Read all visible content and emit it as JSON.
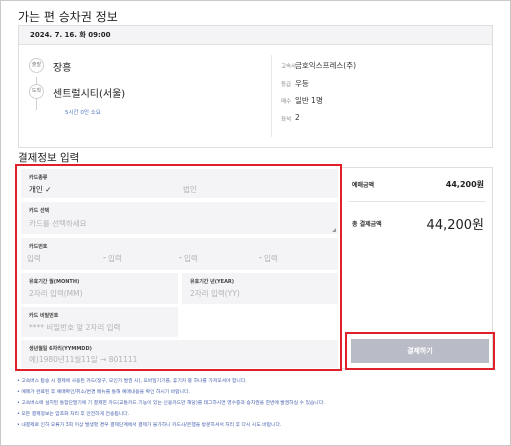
{
  "page": {
    "section_ticket_title": "가는 편 승차권 정보",
    "section_payment_title": "결제정보 입력"
  },
  "ticket": {
    "datetime": "2024. 7. 16. 화 09:00",
    "departure_badge": "출발",
    "arrival_badge": "도착",
    "departure": "장흥",
    "arrival": "센트럴시티(서울)",
    "duration": "5시간 0인 소요",
    "info": [
      {
        "label": "고속사",
        "value": "금호익스프레스(주)"
      },
      {
        "label": "등급",
        "value": "우등"
      },
      {
        "label": "매수",
        "value": "일반 1명"
      },
      {
        "label": "좌석",
        "value": "2"
      }
    ]
  },
  "form": {
    "card_type": {
      "label": "카드종류",
      "selected": "개인 ✓",
      "other": "법인"
    },
    "card_select": {
      "label": "카드 선택",
      "placeholder": "카드를 선택하세요"
    },
    "card_number": {
      "label": "카드번호",
      "placeholders": [
        "입력",
        "입력",
        "입력",
        "입력"
      ],
      "separator": "-"
    },
    "expiry_month": {
      "label": "유효기간 월(MONTH)",
      "placeholder": "2자리 입력(MM)"
    },
    "expiry_year": {
      "label": "유효기간 년(YEAR)",
      "placeholder": "2자리 입력(YY)"
    },
    "card_password": {
      "label": "카드 비밀번호",
      "placeholder": "**** 비밀번호 앞 2자리 입력"
    },
    "birth": {
      "label": "생년월일 6자리(YYMMDD)",
      "placeholder": "예)1980년11월11일 → 801111"
    }
  },
  "summary": {
    "pay_amount_label": "예매금액",
    "pay_amount": "44,200원",
    "total_label": "총 결제금액",
    "total_amount": "44,200원",
    "pay_button": "결제하기"
  },
  "notes": [
    "• 고속버스 탑승 시 결제에 사용된 카드(정구, 모인가 발권 시), 모바일기기를, 휴기카 중 하나를 가져오셔야 합니다.",
    "• 예매가 완료된 후 예매확인/취소/변경 메뉴를 통해 예매내용을 확인 하시기 바랍니다.",
    "• 고속버스에 설치된 통합단말기에 기 결제한 카드(교통카드 기능이 있는 신용카드만 해당)를 태그하시면 영수증과 승차권을 한번에 발권하실 수 있습니다.",
    "• 모든 결제정보는 암호화 처리 후 안전하게 전송됩니다.",
    "• 내결제로 인하 오류가 3회 이상 발생할 경우 결제단계에서 결제가 불가하니 카드사/은행을 방문하셔서 처리 후 다시 시도 바랍니다."
  ],
  "colors": {
    "highlight_border": "#e0212a",
    "field_bg": "#f4f4f6",
    "button_disabled": "#b9bcc6",
    "note_text": "#4a64b0",
    "duration_text": "#4a74c4"
  }
}
